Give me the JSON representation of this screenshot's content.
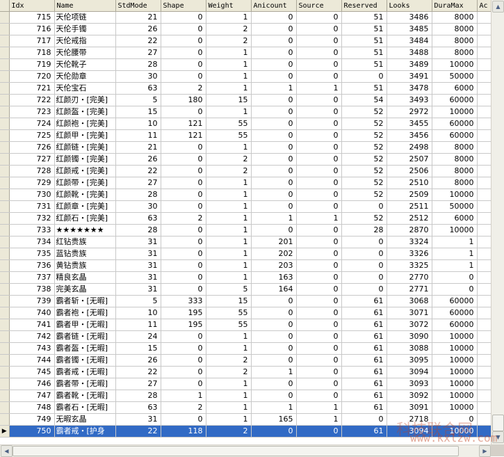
{
  "columns": [
    "",
    "Idx",
    "Name",
    "StdMode",
    "Shape",
    "Weight",
    "Anicount",
    "Source",
    "Reserved",
    "Looks",
    "DuraMax",
    "Ac"
  ],
  "rows": [
    [
      "715",
      "天伦项链",
      "21",
      "0",
      "1",
      "0",
      "0",
      "51",
      "3486",
      "8000",
      ""
    ],
    [
      "716",
      "天伦手镯",
      "26",
      "0",
      "2",
      "0",
      "0",
      "51",
      "3485",
      "8000",
      ""
    ],
    [
      "717",
      "天伦戒指",
      "22",
      "0",
      "2",
      "0",
      "0",
      "51",
      "3484",
      "8000",
      ""
    ],
    [
      "718",
      "天伦腰带",
      "27",
      "0",
      "1",
      "0",
      "0",
      "51",
      "3488",
      "8000",
      ""
    ],
    [
      "719",
      "天伦靴子",
      "28",
      "0",
      "1",
      "0",
      "0",
      "51",
      "3489",
      "10000",
      ""
    ],
    [
      "720",
      "天伦勋章",
      "30",
      "0",
      "1",
      "0",
      "0",
      "0",
      "3491",
      "50000",
      ""
    ],
    [
      "721",
      "天伦宝石",
      "63",
      "2",
      "1",
      "1",
      "1",
      "51",
      "3478",
      "6000",
      ""
    ],
    [
      "722",
      "红颜刃・[完美]",
      "5",
      "180",
      "15",
      "0",
      "0",
      "54",
      "3493",
      "60000",
      ""
    ],
    [
      "723",
      "红颜盔・[完美]",
      "15",
      "0",
      "1",
      "0",
      "0",
      "52",
      "2972",
      "10000",
      ""
    ],
    [
      "724",
      "红颜袍・[完美]",
      "10",
      "121",
      "55",
      "0",
      "0",
      "52",
      "3455",
      "60000",
      ""
    ],
    [
      "725",
      "红颜甲・[完美]",
      "11",
      "121",
      "55",
      "0",
      "0",
      "52",
      "3456",
      "60000",
      ""
    ],
    [
      "726",
      "红颜链・[完美]",
      "21",
      "0",
      "1",
      "0",
      "0",
      "52",
      "2498",
      "8000",
      ""
    ],
    [
      "727",
      "红颜镯・[完美]",
      "26",
      "0",
      "2",
      "0",
      "0",
      "52",
      "2507",
      "8000",
      ""
    ],
    [
      "728",
      "红颜戒・[完美]",
      "22",
      "0",
      "2",
      "0",
      "0",
      "52",
      "2506",
      "8000",
      ""
    ],
    [
      "729",
      "红颜带・[完美]",
      "27",
      "0",
      "1",
      "0",
      "0",
      "52",
      "2510",
      "8000",
      ""
    ],
    [
      "730",
      "红颜靴・[完美]",
      "28",
      "0",
      "1",
      "0",
      "0",
      "52",
      "2509",
      "10000",
      ""
    ],
    [
      "731",
      "红颜章・[完美]",
      "30",
      "0",
      "1",
      "0",
      "0",
      "0",
      "2511",
      "50000",
      ""
    ],
    [
      "732",
      "红颜石・[完美]",
      "63",
      "2",
      "1",
      "1",
      "1",
      "52",
      "2512",
      "6000",
      ""
    ],
    [
      "733",
      "★★★★★★★",
      "28",
      "0",
      "1",
      "0",
      "0",
      "28",
      "2870",
      "10000",
      ""
    ],
    [
      "734",
      "红钻贵族",
      "31",
      "0",
      "1",
      "201",
      "0",
      "0",
      "3324",
      "1",
      ""
    ],
    [
      "735",
      "蓝钻贵族",
      "31",
      "0",
      "1",
      "202",
      "0",
      "0",
      "3326",
      "1",
      ""
    ],
    [
      "736",
      "黄钻贵族",
      "31",
      "0",
      "1",
      "203",
      "0",
      "0",
      "3325",
      "1",
      ""
    ],
    [
      "737",
      "精良玄晶",
      "31",
      "0",
      "1",
      "163",
      "0",
      "0",
      "2770",
      "0",
      ""
    ],
    [
      "738",
      "完美玄晶",
      "31",
      "0",
      "5",
      "164",
      "0",
      "0",
      "2771",
      "0",
      ""
    ],
    [
      "739",
      "霸者斩・[无暇]",
      "5",
      "333",
      "15",
      "0",
      "0",
      "61",
      "3068",
      "60000",
      ""
    ],
    [
      "740",
      "霸者袍・[无暇]",
      "10",
      "195",
      "55",
      "0",
      "0",
      "61",
      "3071",
      "60000",
      ""
    ],
    [
      "741",
      "霸者甲・[无暇]",
      "11",
      "195",
      "55",
      "0",
      "0",
      "61",
      "3072",
      "60000",
      ""
    ],
    [
      "742",
      "霸者链・[无暇]",
      "24",
      "0",
      "1",
      "0",
      "0",
      "61",
      "3090",
      "10000",
      ""
    ],
    [
      "743",
      "霸者盔・[无暇]",
      "15",
      "0",
      "1",
      "0",
      "0",
      "61",
      "3088",
      "10000",
      ""
    ],
    [
      "744",
      "霸者镯・[无暇]",
      "26",
      "0",
      "2",
      "0",
      "0",
      "61",
      "3095",
      "10000",
      ""
    ],
    [
      "745",
      "霸者戒・[无暇]",
      "22",
      "0",
      "2",
      "1",
      "0",
      "61",
      "3094",
      "10000",
      ""
    ],
    [
      "746",
      "霸者带・[无暇]",
      "27",
      "0",
      "1",
      "0",
      "0",
      "61",
      "3093",
      "10000",
      ""
    ],
    [
      "747",
      "霸者靴・[无暇]",
      "28",
      "1",
      "1",
      "0",
      "0",
      "61",
      "3092",
      "10000",
      ""
    ],
    [
      "748",
      "霸者石・[无暇]",
      "63",
      "2",
      "1",
      "1",
      "1",
      "61",
      "3091",
      "10000",
      ""
    ],
    [
      "749",
      "无暇玄晶",
      "31",
      "0",
      "1",
      "165",
      "1",
      "0",
      "2718",
      "0",
      ""
    ],
    [
      "750",
      "霸者戒・[护身",
      "22",
      "118",
      "2",
      "0",
      "0",
      "61",
      "3094",
      "10000",
      ""
    ]
  ],
  "selected_row_index": 35,
  "row_indicator_glyph": "▶",
  "watermark": {
    "top": "科技联合网",
    "bottom": "www.kxlzw.com"
  },
  "colors": {
    "selection": "#316ac5",
    "header": "#ece9d8"
  }
}
